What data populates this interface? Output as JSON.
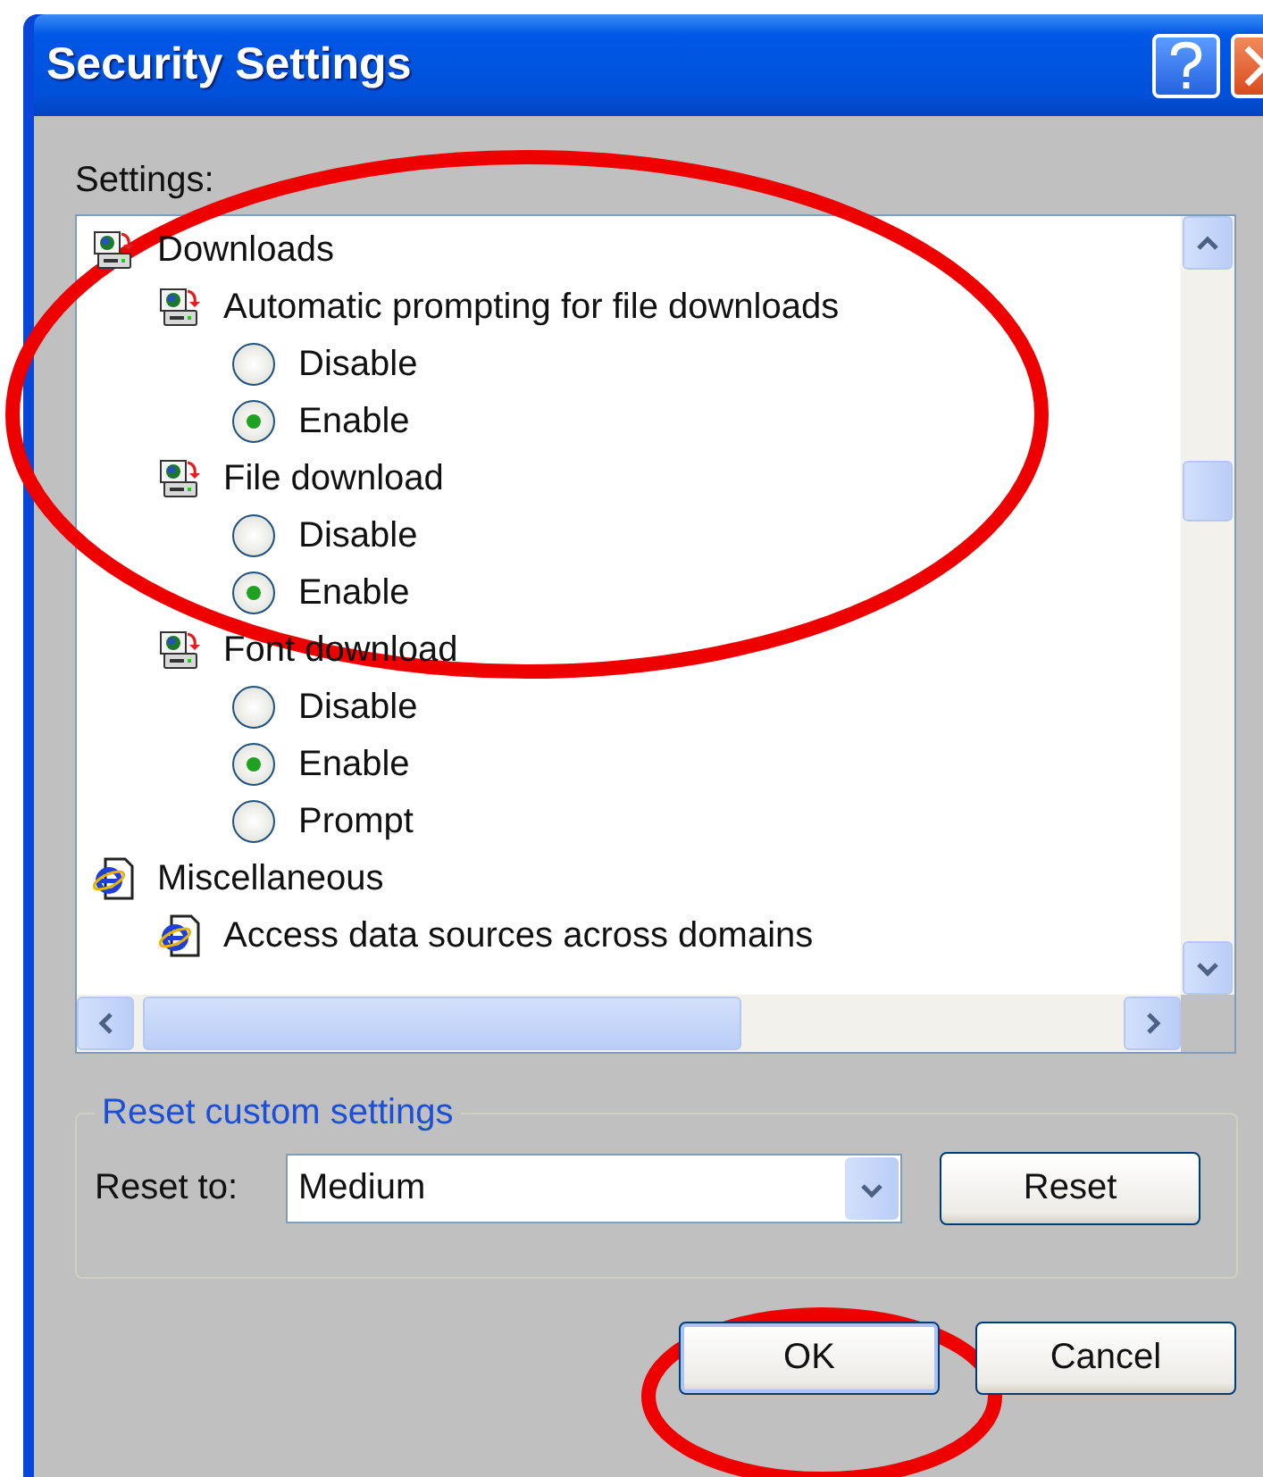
{
  "window": {
    "title": "Security Settings"
  },
  "settings_label": "Settings:",
  "settings": [
    {
      "label": "Downloads",
      "kind": "download",
      "children": [
        {
          "label": "Automatic prompting for file downloads",
          "kind": "download",
          "options": [
            {
              "label": "Disable",
              "selected": false
            },
            {
              "label": "Enable",
              "selected": true
            }
          ]
        },
        {
          "label": "File download",
          "kind": "download",
          "options": [
            {
              "label": "Disable",
              "selected": false
            },
            {
              "label": "Enable",
              "selected": true
            }
          ]
        },
        {
          "label": "Font download",
          "kind": "download",
          "options": [
            {
              "label": "Disable",
              "selected": false
            },
            {
              "label": "Enable",
              "selected": true
            },
            {
              "label": "Prompt",
              "selected": false
            }
          ]
        }
      ]
    },
    {
      "label": "Miscellaneous",
      "kind": "ie",
      "children": [
        {
          "label": "Access data sources across domains",
          "kind": "ie"
        }
      ]
    }
  ],
  "reset_group": {
    "title": "Reset custom settings",
    "label": "Reset to:",
    "dropdown": {
      "value": "Medium"
    },
    "button": "Reset"
  },
  "buttons": [
    {
      "label": "OK",
      "default": true
    },
    {
      "label": "Cancel",
      "default": false
    }
  ],
  "annotations": [
    {
      "kind": "ellipse"
    },
    {
      "kind": "ellipse"
    }
  ]
}
